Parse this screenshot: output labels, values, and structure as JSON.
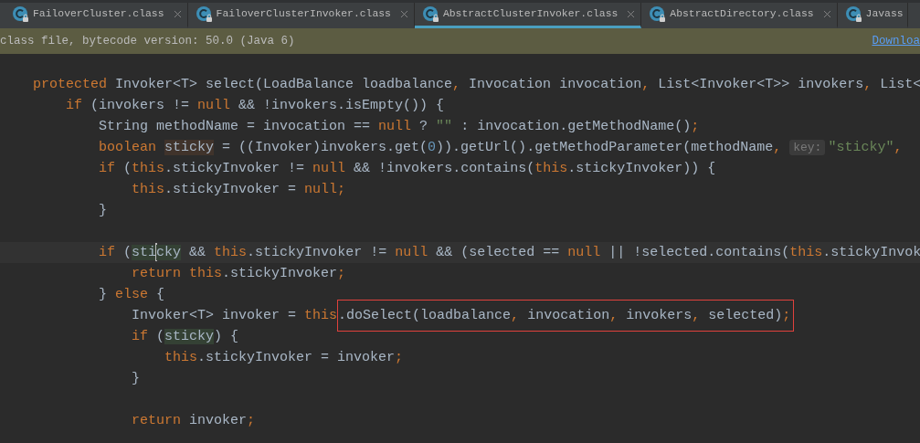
{
  "tabs": [
    {
      "label": "FailoverCluster.class",
      "selected": false,
      "closable": true
    },
    {
      "label": "FailoverClusterInvoker.class",
      "selected": false,
      "closable": true
    },
    {
      "label": "AbstractClusterInvoker.class",
      "selected": true,
      "closable": true
    },
    {
      "label": "AbstractDirectory.class",
      "selected": false,
      "closable": true
    },
    {
      "label": "Javass",
      "selected": false,
      "closable": false
    }
  ],
  "notification": {
    "text": "class file, bytecode version: 50.0 (Java 6)",
    "link": "Downloa"
  },
  "lines": [
    {
      "tokens": [
        {
          "kind": "kw",
          "text": "    protected"
        },
        {
          "kind": "id",
          "text": " Invoker<T> select(LoadBalance loadbalance"
        },
        {
          "kind": "punct",
          "text": ","
        },
        {
          "kind": "id",
          "text": " Invocation invocation"
        },
        {
          "kind": "punct",
          "text": ","
        },
        {
          "kind": "id",
          "text": " List<Invoker<T>> invokers"
        },
        {
          "kind": "punct",
          "text": ","
        },
        {
          "kind": "id",
          "text": " List<"
        }
      ]
    },
    {
      "tokens": [
        {
          "kind": "kw",
          "text": "        if"
        },
        {
          "kind": "id",
          "text": " (invokers != "
        },
        {
          "kind": "kw",
          "text": "null"
        },
        {
          "kind": "id",
          "text": " && !invokers.isEmpty()) {"
        }
      ]
    },
    {
      "tokens": [
        {
          "kind": "id",
          "text": "            String methodName = invocation == "
        },
        {
          "kind": "kw",
          "text": "null"
        },
        {
          "kind": "id",
          "text": " ? "
        },
        {
          "kind": "str",
          "text": "\"\""
        },
        {
          "kind": "id",
          "text": " : invocation.getMethodName()"
        },
        {
          "kind": "punct",
          "text": ";"
        }
      ]
    },
    {
      "tokens": [
        {
          "kind": "kw",
          "text": "            boolean "
        },
        {
          "kind": "write",
          "text": "sticky"
        },
        {
          "kind": "id",
          "text": " = ((Invoker)invokers.get("
        },
        {
          "kind": "num",
          "text": "0"
        },
        {
          "kind": "id",
          "text": ")).getUrl().getMethodParameter(methodName"
        },
        {
          "kind": "punct",
          "text": ", "
        },
        {
          "kind": "hint",
          "text": "key:"
        },
        {
          "kind": "str",
          "text": "\"sticky\""
        },
        {
          "kind": "punct",
          "text": ","
        }
      ]
    },
    {
      "tokens": [
        {
          "kind": "kw",
          "text": "            if"
        },
        {
          "kind": "id",
          "text": " ("
        },
        {
          "kind": "kw",
          "text": "this"
        },
        {
          "kind": "id",
          "text": ".stickyInvoker != "
        },
        {
          "kind": "kw",
          "text": "null"
        },
        {
          "kind": "id",
          "text": " && !invokers.contains("
        },
        {
          "kind": "kw",
          "text": "this"
        },
        {
          "kind": "id",
          "text": ".stickyInvoker)) {"
        }
      ]
    },
    {
      "tokens": [
        {
          "kind": "kw",
          "text": "                this"
        },
        {
          "kind": "id",
          "text": ".stickyInvoker = "
        },
        {
          "kind": "kw",
          "text": "null"
        },
        {
          "kind": "punct",
          "text": ";"
        }
      ]
    },
    {
      "tokens": [
        {
          "kind": "id",
          "text": "            }"
        }
      ]
    },
    {
      "blank_line_before": true,
      "current": true,
      "tokens": [
        {
          "kind": "kw",
          "text": "            if"
        },
        {
          "kind": "id",
          "text": " ("
        },
        {
          "kind": "read",
          "text": "sti"
        },
        {
          "kind": "caret"
        },
        {
          "kind": "read",
          "text": "cky"
        },
        {
          "kind": "id",
          "text": " && "
        },
        {
          "kind": "kw",
          "text": "this"
        },
        {
          "kind": "id",
          "text": ".stickyInvoker != "
        },
        {
          "kind": "kw",
          "text": "null"
        },
        {
          "kind": "id",
          "text": " && (selected == "
        },
        {
          "kind": "kw",
          "text": "null"
        },
        {
          "kind": "id",
          "text": " || !selected.contains("
        },
        {
          "kind": "kw",
          "text": "this"
        },
        {
          "kind": "id",
          "text": ".stickyInvok"
        }
      ]
    },
    {
      "tokens": [
        {
          "kind": "kw",
          "text": "                return this"
        },
        {
          "kind": "id",
          "text": ".stickyInvoker"
        },
        {
          "kind": "punct",
          "text": ";"
        }
      ]
    },
    {
      "tokens": [
        {
          "kind": "id",
          "text": "            } "
        },
        {
          "kind": "kw",
          "text": "else"
        },
        {
          "kind": "id",
          "text": " {"
        }
      ]
    },
    {
      "tokens": [
        {
          "kind": "id",
          "text": "                Invoker<T> invoker = "
        },
        {
          "kind": "kw",
          "text": "this"
        }
      ],
      "boxed": [
        {
          "kind": "id",
          "text": ".doSelect(loadbalance"
        },
        {
          "kind": "punct",
          "text": ","
        },
        {
          "kind": "id",
          "text": " invocation"
        },
        {
          "kind": "punct",
          "text": ","
        },
        {
          "kind": "id",
          "text": " invokers"
        },
        {
          "kind": "punct",
          "text": ","
        },
        {
          "kind": "id",
          "text": " selected)"
        },
        {
          "kind": "punct",
          "text": ";"
        }
      ]
    },
    {
      "tokens": [
        {
          "kind": "kw",
          "text": "                if"
        },
        {
          "kind": "id",
          "text": " ("
        },
        {
          "kind": "read",
          "text": "sticky"
        },
        {
          "kind": "id",
          "text": ") {"
        }
      ]
    },
    {
      "tokens": [
        {
          "kind": "kw",
          "text": "                    this"
        },
        {
          "kind": "id",
          "text": ".stickyInvoker = invoker"
        },
        {
          "kind": "punct",
          "text": ";"
        }
      ]
    },
    {
      "tokens": [
        {
          "kind": "id",
          "text": "                }"
        }
      ]
    },
    {
      "blank_line_before": true,
      "tokens": [
        {
          "kind": "kw",
          "text": "                return"
        },
        {
          "kind": "id",
          "text": " invoker"
        },
        {
          "kind": "punct",
          "text": ";"
        }
      ]
    }
  ]
}
